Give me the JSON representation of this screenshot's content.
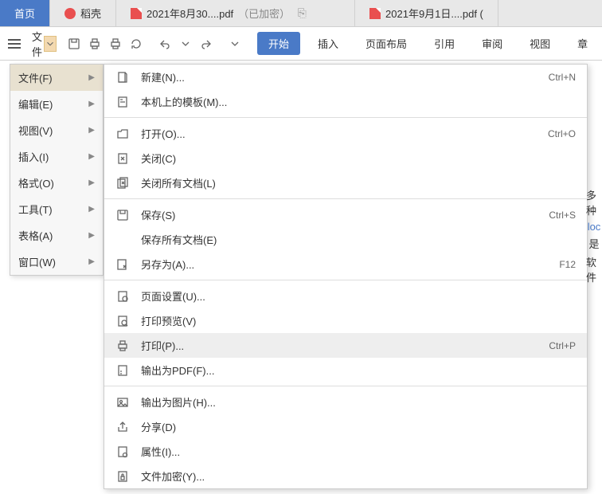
{
  "tabs": {
    "home": "首页",
    "docer": "稻壳",
    "pdf1_name": "2021年8月30....pdf",
    "pdf1_suffix": "（已加密）",
    "pdf2_name": "2021年9月1日....pdf  ("
  },
  "toolbar": {
    "file": "文件",
    "start": "开始",
    "insert": "插入",
    "layout": "页面布局",
    "ref": "引用",
    "review": "审阅",
    "view": "视图",
    "chapter": "章"
  },
  "sidemenu": {
    "file": "文件(F)",
    "edit": "编辑(E)",
    "view": "视图(V)",
    "insert": "插入(I)",
    "format": "格式(O)",
    "tool": "工具(T)",
    "table": "表格(A)",
    "window": "窗口(W)"
  },
  "submenu": {
    "new": "新建(N)...",
    "template": "本机上的模板(M)...",
    "open": "打开(O)...",
    "close": "关闭(C)",
    "closeall": "关闭所有文档(L)",
    "save": "保存(S)",
    "saveall": "保存所有文档(E)",
    "saveas": "另存为(A)...",
    "pagesetup": "页面设置(U)...",
    "preview": "打印预览(V)",
    "print": "打印(P)...",
    "exportpdf": "输出为PDF(F)...",
    "exportimg": "输出为图片(H)...",
    "share": "分享(D)",
    "props": "属性(I)...",
    "encrypt": "文件加密(Y)..."
  },
  "shortcuts": {
    "new": "Ctrl+N",
    "open": "Ctrl+O",
    "save": "Ctrl+S",
    "saveas": "F12",
    "print": "Ctrl+P"
  },
  "docpeek": {
    "a": "多种",
    "b": "loc",
    "c": "是",
    "d": "软件"
  }
}
